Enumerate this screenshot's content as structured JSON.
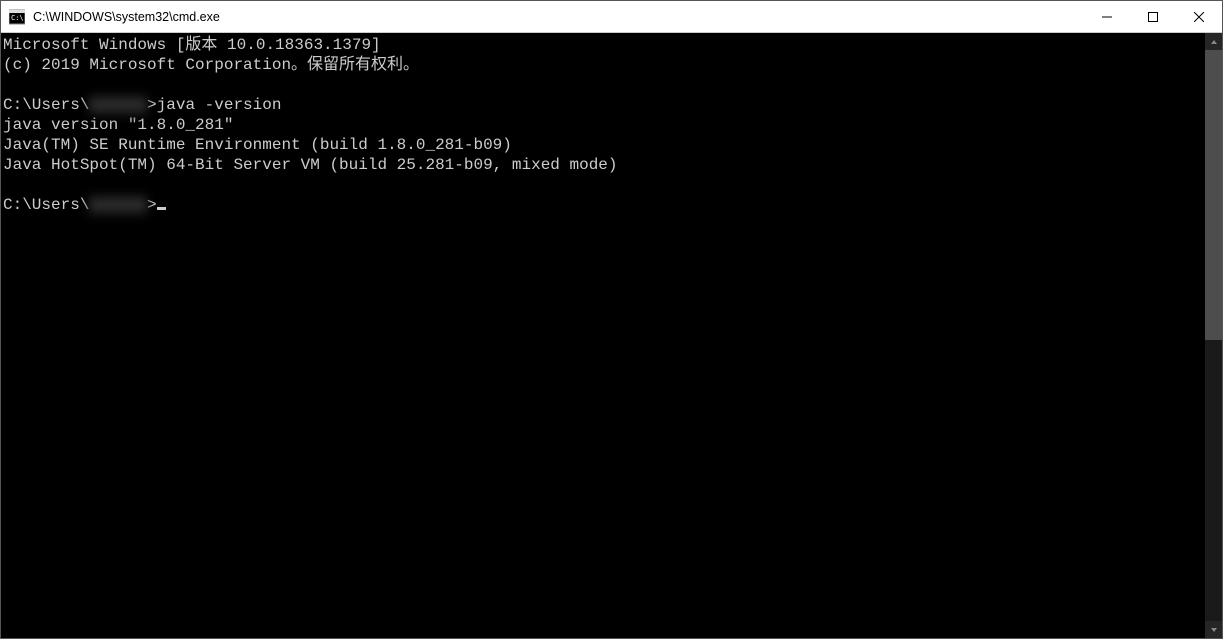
{
  "titlebar": {
    "title": "C:\\WINDOWS\\system32\\cmd.exe"
  },
  "terminal": {
    "line1": "Microsoft Windows [版本 10.0.18363.1379]",
    "line2": "(c) 2019 Microsoft Corporation。保留所有权利。",
    "prompt1_prefix": "C:\\Users\\",
    "prompt1_redacted": "xxxxxx",
    "prompt1_suffix": ">",
    "command1": "java -version",
    "out1": "java version \"1.8.0_281\"",
    "out2": "Java(TM) SE Runtime Environment (build 1.8.0_281-b09)",
    "out3": "Java HotSpot(TM) 64-Bit Server VM (build 25.281-b09, mixed mode)",
    "prompt2_prefix": "C:\\Users\\",
    "prompt2_redacted": "xxxxxx",
    "prompt2_suffix": ">"
  }
}
